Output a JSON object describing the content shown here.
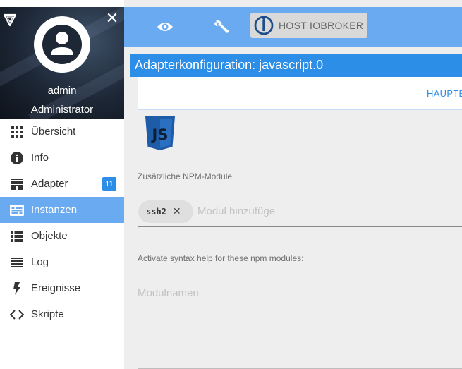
{
  "sidebar": {
    "user_name": "admin",
    "user_role": "Administrator",
    "close_glyph": "✕",
    "items": [
      {
        "label": "Übersicht",
        "icon": "grid-icon"
      },
      {
        "label": "Info",
        "icon": "info-icon"
      },
      {
        "label": "Adapter",
        "icon": "store-icon",
        "badge": "11"
      },
      {
        "label": "Instanzen",
        "icon": "instances-icon",
        "active": true
      },
      {
        "label": "Objekte",
        "icon": "list-icon"
      },
      {
        "label": "Log",
        "icon": "lines-icon"
      },
      {
        "label": "Ereignisse",
        "icon": "bolt-icon"
      },
      {
        "label": "Skripte",
        "icon": "code-icon"
      }
    ]
  },
  "topbar": {
    "host_label": "HOST IOBROKER"
  },
  "panel": {
    "title": "Adapterkonfiguration: javascript.0",
    "tab_label": "HAUPTE",
    "js_logo_text": "JS",
    "npm_label": "Zusätzliche NPM-Module",
    "chip_label": "ssh2",
    "chip_remove": "✕",
    "module_placeholder": "Modul hinzufüge",
    "syntax_label": "Activate syntax help for these npm modules:",
    "modname_placeholder": "Modulnamen"
  },
  "colors": {
    "accent": "#2d8ee8",
    "topbar": "#6aaaf0",
    "active_item": "#6aaaf0",
    "js_blue": "#1f5ca8"
  }
}
